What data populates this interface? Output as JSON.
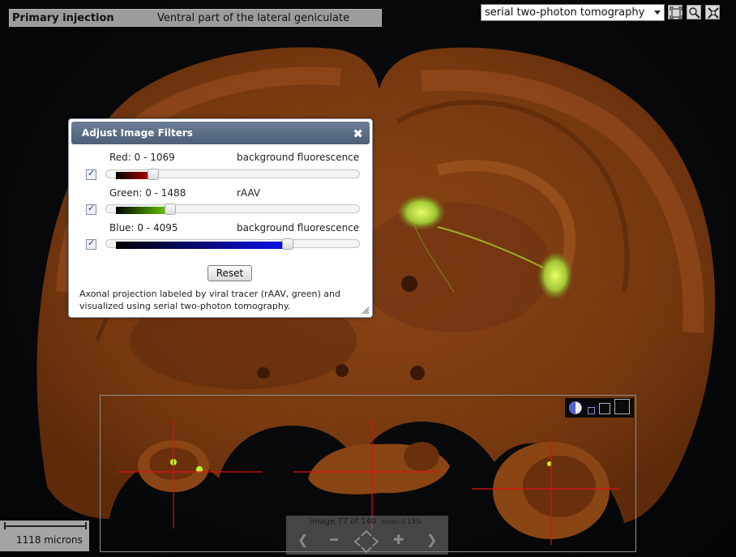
{
  "info": {
    "label": "Primary injection",
    "value": "Ventral part of the lateral geniculate"
  },
  "toolbar": {
    "modality": "serial two-photon tomography",
    "buttons": [
      "fit-view-icon",
      "zoom-region-icon",
      "settings-icon"
    ]
  },
  "dialog": {
    "title": "Adjust Image Filters",
    "close_icon": "close-icon",
    "channels": [
      {
        "label": "Red: 0 - 1069",
        "desc": "background fluorescence",
        "checked": true,
        "level": 0.16,
        "color": "#c80000"
      },
      {
        "label": "Green: 0 - 1488",
        "desc": "rAAV",
        "checked": true,
        "level": 0.23,
        "color": "#6bd400"
      },
      {
        "label": "Blue: 0 - 4095",
        "desc": "background fluorescence",
        "checked": true,
        "level": 0.73,
        "color": "#1010f0"
      }
    ],
    "reset_label": "Reset",
    "note": "Axonal projection labeled by viral tracer (rAAV, green) and visualized using serial two-photon tomography."
  },
  "navigator": {
    "image_count": "image 77 of 140",
    "zoom": "zoom:3.13%",
    "tools": [
      "contrast-icon",
      "small-square-icon",
      "medium-square-icon",
      "large-square-icon"
    ]
  },
  "scale": {
    "text": "1118 microns"
  },
  "colors": {
    "tissue": "#7a3a12",
    "signal": "#b8ff30",
    "crosshair": "#e01010",
    "header": "#5a6b85"
  }
}
